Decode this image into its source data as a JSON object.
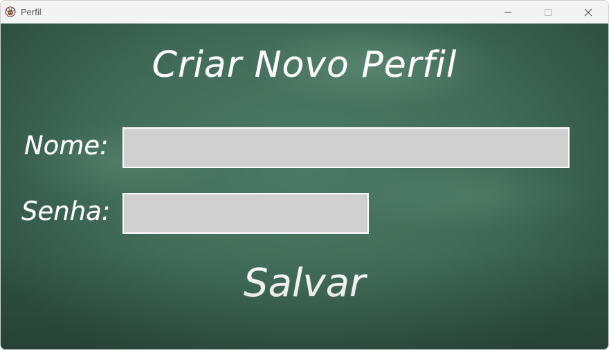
{
  "window": {
    "title": "Perfil",
    "app_icon": "sheep-avatar-icon",
    "controls": [
      "minimize-icon",
      "maximize-icon",
      "close-icon"
    ]
  },
  "form": {
    "heading": "Criar Novo Perfil",
    "name_label": "Nome:",
    "name_value": "",
    "password_label": "Senha:",
    "password_value": "",
    "save_label": "Salvar"
  },
  "colors": {
    "chalkboard": "#416c59",
    "field_fill": "#d0d0d0",
    "chalk_text": "#ffffff",
    "titlebar": "#f3f3f3"
  }
}
